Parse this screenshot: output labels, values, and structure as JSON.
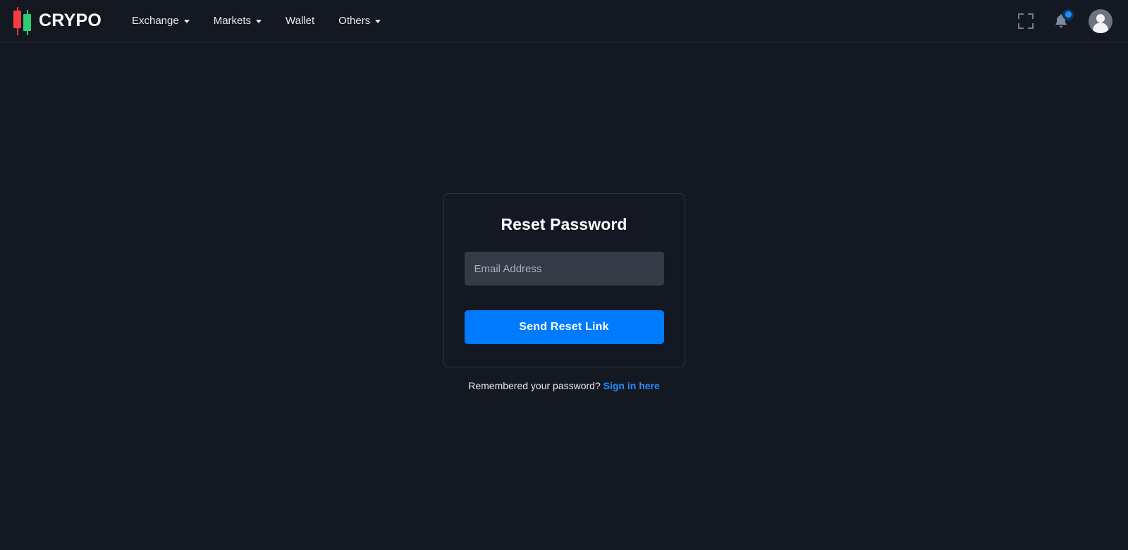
{
  "brand": {
    "name": "CRYPO",
    "logo_icon": "candlestick-logo-icon",
    "colors": {
      "red_candle": "#f63b44",
      "green_candle": "#2ecc71"
    }
  },
  "navbar": {
    "items": [
      {
        "label": "Exchange",
        "has_dropdown": true
      },
      {
        "label": "Markets",
        "has_dropdown": true
      },
      {
        "label": "Wallet",
        "has_dropdown": false
      },
      {
        "label": "Others",
        "has_dropdown": true
      }
    ],
    "actions": {
      "fullscreen_icon": "fullscreen-icon",
      "notifications_icon": "bell-icon",
      "notifications_badge": "",
      "avatar_icon": "user-avatar-icon"
    }
  },
  "auth": {
    "title": "Reset Password",
    "email": {
      "value": "",
      "placeholder": "Email Address"
    },
    "submit_label": "Send Reset Link",
    "footer_text": "Remembered your password?",
    "footer_link_label": "Sign in here"
  },
  "theme": {
    "background": "#141821",
    "card_background": "#141822",
    "card_border": "#2b3140",
    "input_background": "#343b47",
    "accent": "#007bff",
    "link": "#1f8fff"
  }
}
